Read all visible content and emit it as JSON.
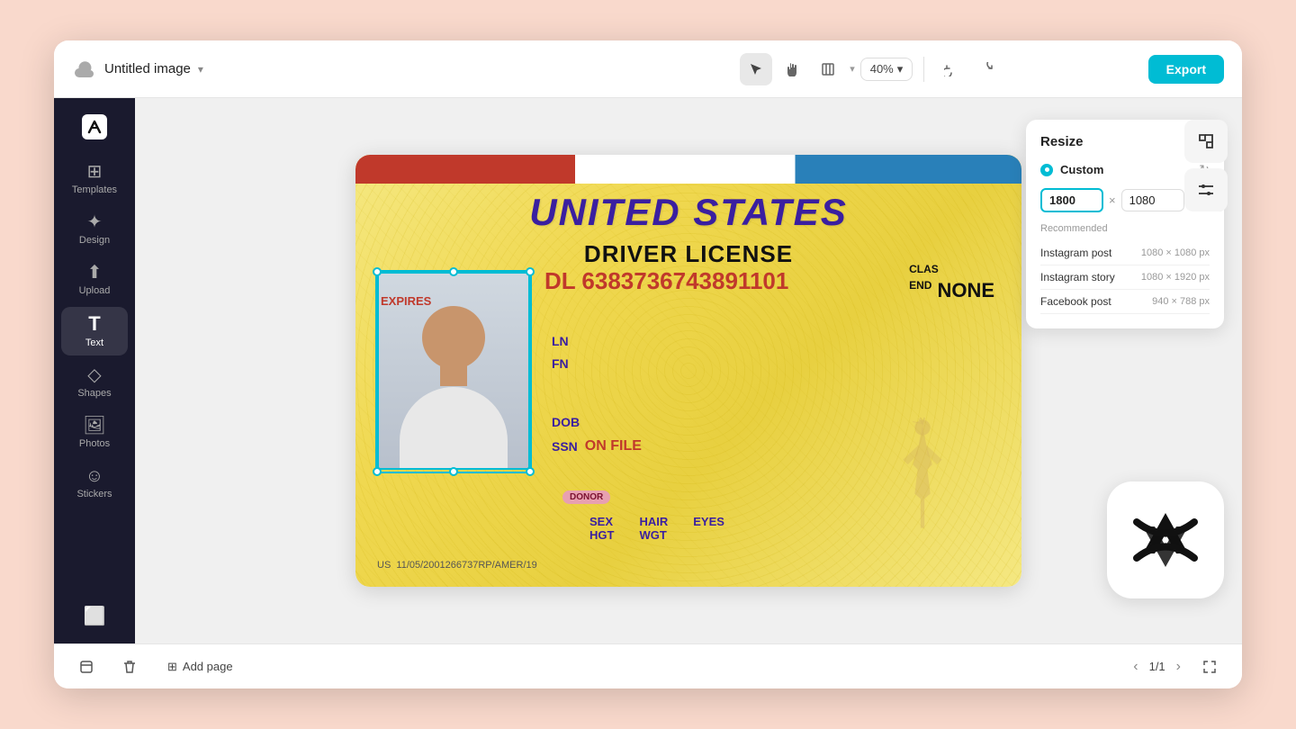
{
  "app": {
    "title": "Untitled image",
    "export_label": "Export",
    "zoom": "40%",
    "add_page": "Add page",
    "page_count": "1/1"
  },
  "sidebar": {
    "items": [
      {
        "id": "templates",
        "label": "Templates",
        "icon": "⊞"
      },
      {
        "id": "design",
        "label": "Design",
        "icon": "✦"
      },
      {
        "id": "upload",
        "label": "Upload",
        "icon": "↑"
      },
      {
        "id": "text",
        "label": "Text",
        "icon": "T"
      },
      {
        "id": "shapes",
        "label": "Shapes",
        "icon": "◇"
      },
      {
        "id": "photos",
        "label": "Photos",
        "icon": "🖼"
      },
      {
        "id": "stickers",
        "label": "Stickers",
        "icon": "☺"
      }
    ]
  },
  "resize_panel": {
    "title": "Resize",
    "custom_label": "Custom",
    "width": "1800",
    "height": "1080",
    "unit": "px",
    "recommended_label": "Recommended",
    "presets": [
      {
        "name": "Instagram post",
        "size": "1080 × 1080 px"
      },
      {
        "name": "Instagram story",
        "size": "1080 × 1920 px"
      },
      {
        "name": "Facebook post",
        "size": "940 × 788 px"
      }
    ]
  },
  "license": {
    "country": "UNITED STATES",
    "type": "DRIVER LICENSE",
    "expires": "EXPIRES",
    "dl_number": "DL  6383736743891101",
    "ln": "LN",
    "fn": "FN",
    "dob_label": "DOB",
    "ssn_label": "SSN",
    "on_file": "ON FILE",
    "donor": "DONOR",
    "sex": "SEX",
    "hgt": "HGT",
    "hair": "HAIR",
    "wgt": "WGT",
    "eyes": "EYES",
    "class_label": "CLAS",
    "end_label": "END",
    "none_val": "NONE",
    "us_label": "US",
    "barcode": "11/05/2001266737RP/AMER/19"
  }
}
